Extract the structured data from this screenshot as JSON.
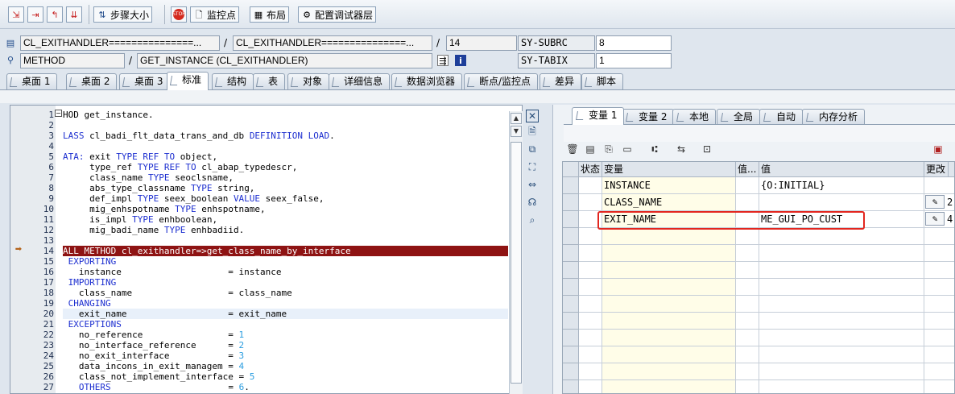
{
  "toolbar": {
    "step_size_label": "步骤大小",
    "watchpoint_label": "监控点",
    "layout_label": "布局",
    "configure_label": "配置调试器层"
  },
  "header": {
    "program_main": "CL_EXITHANDLER===============...",
    "program_include": "CL_EXITHANDLER===============...",
    "line": "14",
    "sy_subrc_label": "SY-SUBRC",
    "sy_subrc_value": "8",
    "event_type": "METHOD",
    "event_name": "GET_INSTANCE (CL_EXITHANDLER)",
    "sy_tabix_label": "SY-TABIX",
    "sy_tabix_value": "1"
  },
  "tabs": [
    {
      "label": "桌面 1"
    },
    {
      "label": "桌面 2"
    },
    {
      "label": "桌面 3"
    },
    {
      "label": "标准"
    },
    {
      "label": "结构"
    },
    {
      "label": "表"
    },
    {
      "label": "对象"
    },
    {
      "label": "详细信息"
    },
    {
      "label": "数据浏览器"
    },
    {
      "label": "断点/监控点"
    },
    {
      "label": "差异"
    },
    {
      "label": "脚本"
    }
  ],
  "code_lines": [
    {
      "no": "1",
      "text": "HOD get_instance."
    },
    {
      "no": "2",
      "text": ""
    },
    {
      "no": "3",
      "text": "LASS cl_badi_flt_data_trans_and_db DEFINITION LOAD."
    },
    {
      "no": "4",
      "text": ""
    },
    {
      "no": "5",
      "text": "ATA: exit TYPE REF TO object,"
    },
    {
      "no": "6",
      "text": "     type_ref TYPE REF TO cl_abap_typedescr,"
    },
    {
      "no": "7",
      "text": "     class_name TYPE seoclsname,"
    },
    {
      "no": "8",
      "text": "     abs_type_classname TYPE string,"
    },
    {
      "no": "9",
      "text": "     def_impl TYPE seex_boolean VALUE seex_false,"
    },
    {
      "no": "10",
      "text": "     mig_enhspotname TYPE enhspotname,"
    },
    {
      "no": "11",
      "text": "     is_impl TYPE enhboolean,"
    },
    {
      "no": "12",
      "text": "     mig_badi_name TYPE enhbadiid."
    },
    {
      "no": "13",
      "text": ""
    },
    {
      "no": "14",
      "text": "ALL METHOD cl_exithandler=>get_class_name_by_interface"
    },
    {
      "no": "15",
      "text": " EXPORTING"
    },
    {
      "no": "16",
      "text": "   instance                    = instance"
    },
    {
      "no": "17",
      "text": " IMPORTING"
    },
    {
      "no": "18",
      "text": "   class_name                  = class_name"
    },
    {
      "no": "19",
      "text": " CHANGING"
    },
    {
      "no": "20",
      "text": "   exit_name                   = exit_name"
    },
    {
      "no": "21",
      "text": " EXCEPTIONS"
    },
    {
      "no": "22",
      "text": "   no_reference                = 1"
    },
    {
      "no": "23",
      "text": "   no_interface_reference      = 2"
    },
    {
      "no": "24",
      "text": "   no_exit_interface           = 3"
    },
    {
      "no": "25",
      "text": "   data_incons_in_exit_managem = 4"
    },
    {
      "no": "26",
      "text": "   class_not_implement_interface = 5"
    },
    {
      "no": "27",
      "text": "   OTHERS                      = 6."
    }
  ],
  "var_tabs": [
    {
      "label": "变量 1"
    },
    {
      "label": "变量 2"
    },
    {
      "label": "本地"
    },
    {
      "label": "全局"
    },
    {
      "label": "自动"
    },
    {
      "label": "内存分析"
    }
  ],
  "grid": {
    "headers": {
      "status": "状态",
      "variable": "变量",
      "value_short": "值...",
      "value": "值",
      "change": "更改"
    },
    "rows": [
      {
        "variable": "INSTANCE",
        "value": "{O:INITIAL}",
        "change": ""
      },
      {
        "variable": "CLASS_NAME",
        "value": "",
        "change": "2"
      },
      {
        "variable": "EXIT_NAME",
        "value": "ME_GUI_PO_CUST",
        "change": "4"
      }
    ]
  }
}
